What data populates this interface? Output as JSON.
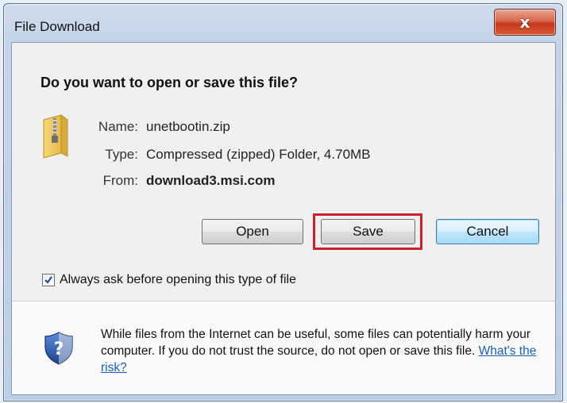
{
  "window": {
    "title": "File Download",
    "close_label": "x"
  },
  "dialog": {
    "question": "Do you want to open or save this file?",
    "file": {
      "name_label": "Name:",
      "name_value": "unetbootin.zip",
      "type_label": "Type:",
      "type_value": "Compressed (zipped) Folder, 4.70MB",
      "from_label": "From:",
      "from_value": "download3.msi.com"
    },
    "buttons": {
      "open_label": "Open",
      "save_label": "Save",
      "cancel_label": "Cancel"
    },
    "checkbox": {
      "label": "Always ask before opening this type of file",
      "checked": true
    },
    "warning": {
      "text": "While files from the Internet can be useful, some files can potentially harm your computer. If you do not trust the source, do not open or save this file.",
      "link_label": "What's the risk?"
    }
  },
  "icons": {
    "file": "zip-folder-icon",
    "security": "shield-question-icon",
    "close": "close-icon"
  },
  "colors": {
    "highlight": "#d0202e",
    "link": "#1a5fc0",
    "close_button": "#c5381c"
  }
}
